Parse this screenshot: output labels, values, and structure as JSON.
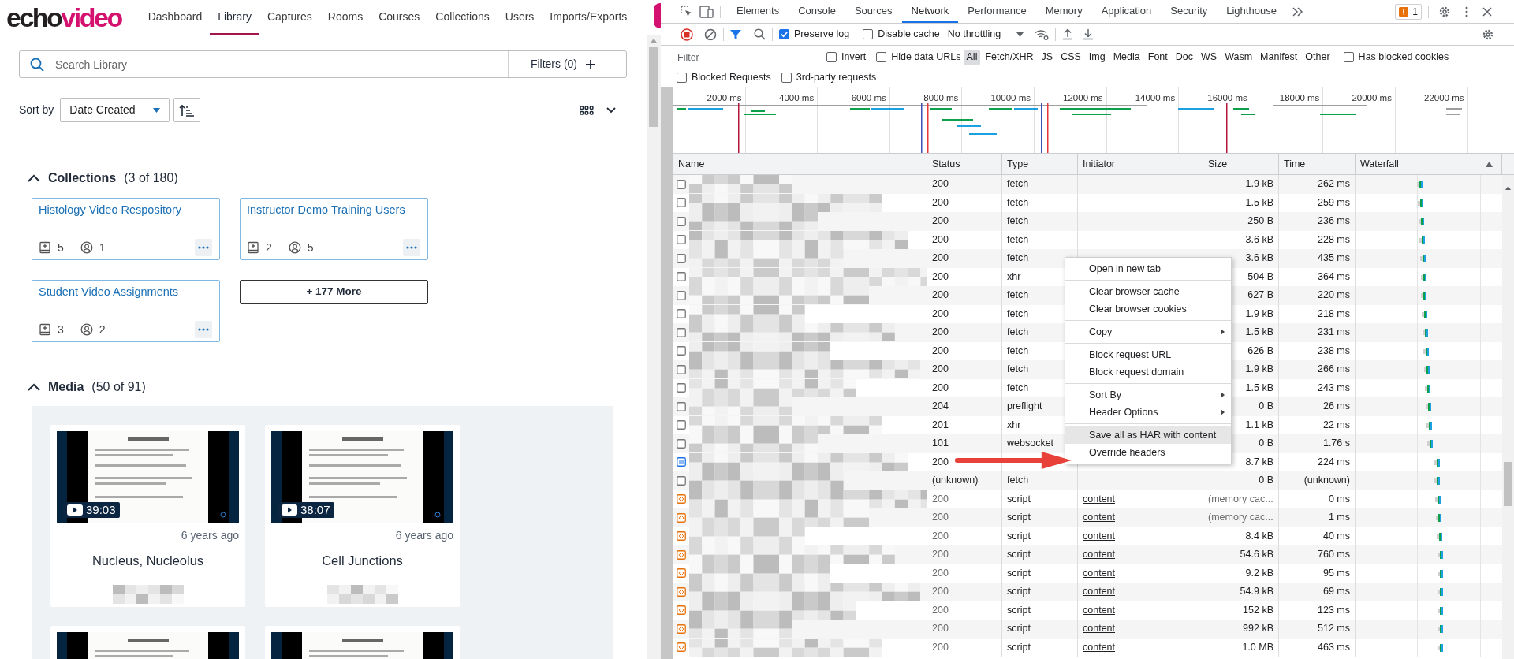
{
  "app": {
    "logo": {
      "part_1": "echo",
      "part_2": "video"
    },
    "nav": [
      {
        "label": "Dashboard",
        "selected": false
      },
      {
        "label": "Library",
        "selected": true
      },
      {
        "label": "Captures",
        "selected": false
      },
      {
        "label": "Rooms",
        "selected": false
      },
      {
        "label": "Courses",
        "selected": false
      },
      {
        "label": "Collections",
        "selected": false
      },
      {
        "label": "Users",
        "selected": false
      },
      {
        "label": "Imports/Exports",
        "selected": false
      }
    ],
    "search": {
      "placeholder": "Search Library",
      "filters": "Filters (0)"
    },
    "sort": {
      "label": "Sort by",
      "value": "Date Created"
    },
    "collections": {
      "title": "Collections",
      "count": "(3 of 180)",
      "expanded": true,
      "items": [
        {
          "title": "Histology Video Respository",
          "media": "5",
          "users": "1"
        },
        {
          "title": "Instructor Demo Training Users",
          "media": "2",
          "users": "5"
        },
        {
          "title": "Student Video Assignments",
          "media": "3",
          "users": "2"
        }
      ],
      "more": "+ 177 More"
    },
    "media": {
      "title": "Media",
      "count": "(50 of 91)",
      "expanded": true,
      "items": [
        {
          "kind": "video",
          "duration": "39:03",
          "age": "6 years ago",
          "title": "Nucleus, Nucleolus"
        },
        {
          "kind": "video",
          "duration": "38:07",
          "age": "6 years ago",
          "title": "Cell Junctions"
        },
        {
          "kind": "picture"
        },
        {
          "kind": "picture"
        }
      ]
    }
  },
  "devtools": {
    "tabs": [
      {
        "label": "Elements",
        "selected": false
      },
      {
        "label": "Console",
        "selected": false
      },
      {
        "label": "Sources",
        "selected": false
      },
      {
        "label": "Network",
        "selected": true
      },
      {
        "label": "Performance",
        "selected": false
      },
      {
        "label": "Memory",
        "selected": false
      },
      {
        "label": "Application",
        "selected": false
      },
      {
        "label": "Security",
        "selected": false
      },
      {
        "label": "Lighthouse",
        "selected": false
      }
    ],
    "issues_badge": "1",
    "toolbar": {
      "preserve_log": {
        "label": "Preserve log",
        "checked": true
      },
      "disable_cache": {
        "label": "Disable cache",
        "checked": false
      },
      "throttling": "No throttling"
    },
    "filter": {
      "placeholder": "Filter",
      "options": [
        {
          "label": "Invert",
          "checked": false
        },
        {
          "label": "Hide data URLs",
          "checked": false
        }
      ],
      "types": [
        {
          "label": "All",
          "selected": true
        },
        {
          "label": "Fetch/XHR",
          "selected": false
        },
        {
          "label": "JS",
          "selected": false
        },
        {
          "label": "CSS",
          "selected": false
        },
        {
          "label": "Img",
          "selected": false
        },
        {
          "label": "Media",
          "selected": false
        },
        {
          "label": "Font",
          "selected": false
        },
        {
          "label": "Doc",
          "selected": false
        },
        {
          "label": "WS",
          "selected": false
        },
        {
          "label": "Wasm",
          "selected": false
        },
        {
          "label": "Manifest",
          "selected": false
        },
        {
          "label": "Other",
          "selected": false
        }
      ],
      "blocked_cookies": {
        "label": "Has blocked cookies",
        "checked": false
      },
      "row_2": [
        {
          "label": "Blocked Requests",
          "checked": false
        },
        {
          "label": "3rd-party requests",
          "checked": false
        }
      ]
    },
    "overview": {
      "ticks": [
        "2000 ms",
        "4000 ms",
        "6000 ms",
        "8000 ms",
        "10000 ms",
        "12000 ms",
        "14000 ms",
        "16000 ms",
        "18000 ms",
        "20000 ms",
        "22000 ms"
      ]
    },
    "table": {
      "columns": [
        "Name",
        "Status",
        "Type",
        "Initiator",
        "Size",
        "Time",
        "Waterfall"
      ],
      "rows": [
        {
          "kind": "request",
          "status": "200",
          "type": "fetch",
          "size": "1.9 kB",
          "time": "262 ms"
        },
        {
          "kind": "request",
          "status": "200",
          "type": "fetch",
          "size": "1.5 kB",
          "time": "259 ms"
        },
        {
          "kind": "request",
          "status": "200",
          "type": "fetch",
          "size": "250 B",
          "time": "236 ms"
        },
        {
          "kind": "request",
          "status": "200",
          "type": "fetch",
          "size": "3.6 kB",
          "time": "228 ms"
        },
        {
          "kind": "request",
          "status": "200",
          "type": "fetch",
          "size": "3.6 kB",
          "time": "435 ms"
        },
        {
          "kind": "request",
          "status": "200",
          "type": "xhr",
          "size": "504 B",
          "time": "364 ms"
        },
        {
          "kind": "request",
          "status": "200",
          "type": "fetch",
          "size": "627 B",
          "time": "220 ms"
        },
        {
          "kind": "request",
          "status": "200",
          "type": "fetch",
          "size": "1.9 kB",
          "time": "218 ms"
        },
        {
          "kind": "request",
          "status": "200",
          "type": "fetch",
          "size": "1.5 kB",
          "time": "231 ms"
        },
        {
          "kind": "request",
          "status": "200",
          "type": "fetch",
          "size": "626 B",
          "time": "238 ms"
        },
        {
          "kind": "request",
          "status": "200",
          "type": "fetch",
          "size": "1.9 kB",
          "time": "266 ms"
        },
        {
          "kind": "request",
          "status": "200",
          "type": "fetch",
          "size": "1.5 kB",
          "time": "243 ms"
        },
        {
          "kind": "request",
          "status": "204",
          "type": "preflight",
          "size": "0 B",
          "time": "26 ms"
        },
        {
          "kind": "request",
          "status": "201",
          "type": "xhr",
          "size": "1.1 kB",
          "time": "22 ms"
        },
        {
          "kind": "request",
          "status": "101",
          "type": "websocket",
          "size": "0 B",
          "time": "1.76 s"
        },
        {
          "kind": "document",
          "status": "200",
          "size": "8.7 kB",
          "time": "224 ms"
        },
        {
          "kind": "request",
          "status": "(unknown)",
          "type": "fetch",
          "size": "0 B",
          "time": "(unknown)"
        },
        {
          "kind": "script",
          "status": "200",
          "type": "script",
          "initiator": "content",
          "size": "(memory cac...",
          "cached": true,
          "time": "0 ms"
        },
        {
          "kind": "script",
          "status": "200",
          "type": "script",
          "initiator": "content",
          "size": "(memory cac...",
          "cached": true,
          "time": "1 ms"
        },
        {
          "kind": "script",
          "status": "200",
          "type": "script",
          "initiator": "content",
          "size": "8.4 kB",
          "time": "40 ms"
        },
        {
          "kind": "script",
          "status": "200",
          "type": "script",
          "initiator": "content",
          "size": "54.6 kB",
          "time": "760 ms"
        },
        {
          "kind": "script",
          "status": "200",
          "type": "script",
          "initiator": "content",
          "size": "9.2 kB",
          "time": "95 ms"
        },
        {
          "kind": "script",
          "status": "200",
          "type": "script",
          "initiator": "content",
          "size": "54.9 kB",
          "time": "69 ms"
        },
        {
          "kind": "script",
          "status": "200",
          "type": "script",
          "initiator": "content",
          "size": "152 kB",
          "time": "123 ms"
        },
        {
          "kind": "script",
          "status": "200",
          "type": "script",
          "initiator": "content",
          "size": "992 kB",
          "time": "512 ms"
        },
        {
          "kind": "script",
          "status": "200",
          "type": "script",
          "initiator": "content",
          "size": "1.0 MB",
          "time": "463 ms"
        }
      ]
    },
    "context_menu": {
      "groups": [
        [
          {
            "label": "Open in new tab",
            "submenu": false,
            "selected": false
          }
        ],
        [
          {
            "label": "Clear browser cache",
            "submenu": false,
            "selected": false
          },
          {
            "label": "Clear browser cookies",
            "submenu": false,
            "selected": false
          }
        ],
        [
          {
            "label": "Copy",
            "submenu": true,
            "selected": false
          }
        ],
        [
          {
            "label": "Block request URL",
            "submenu": false,
            "selected": false
          },
          {
            "label": "Block request domain",
            "submenu": false,
            "selected": false
          }
        ],
        [
          {
            "label": "Sort By",
            "submenu": true,
            "selected": false
          },
          {
            "label": "Header Options",
            "submenu": true,
            "selected": false
          }
        ],
        [
          {
            "label": "Save all as HAR with content",
            "submenu": false,
            "selected": true
          },
          {
            "label": "Override headers",
            "submenu": false,
            "selected": false
          }
        ]
      ]
    }
  }
}
